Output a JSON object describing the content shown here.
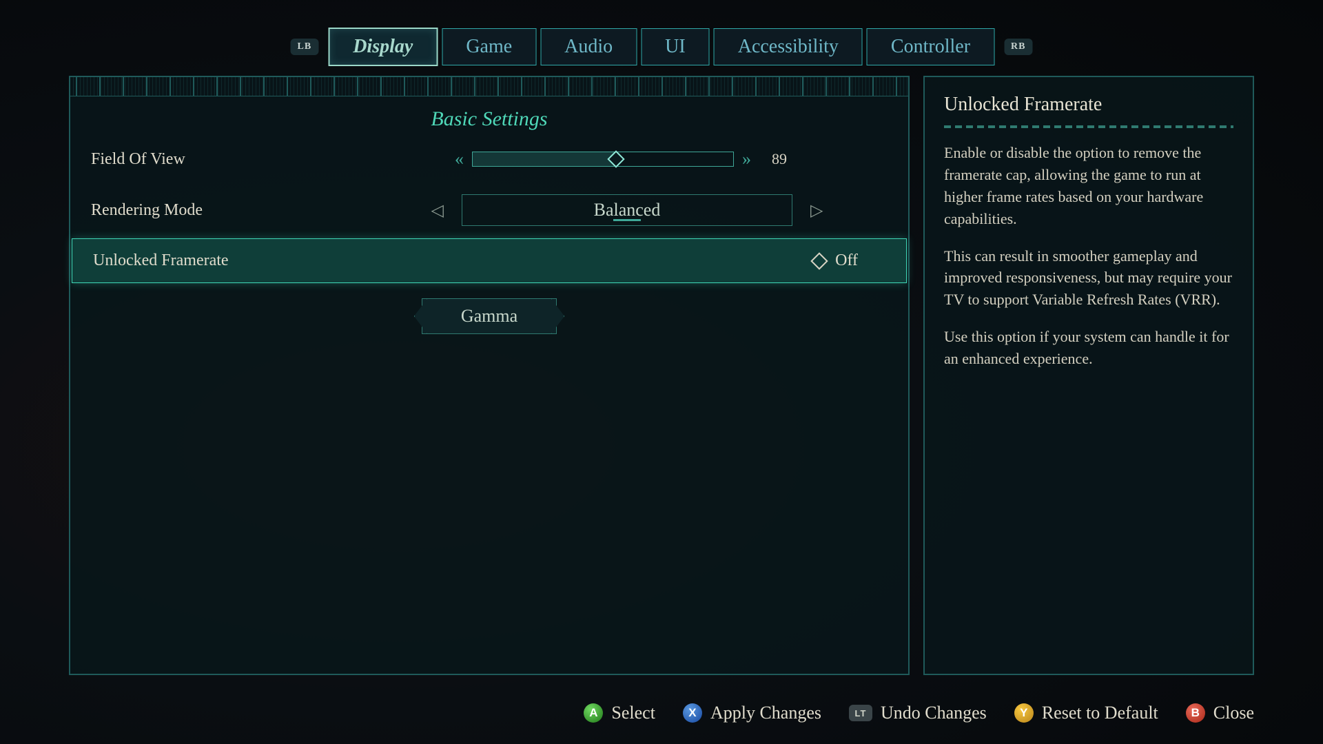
{
  "tabs": {
    "lb_hint": "LB",
    "rb_hint": "RB",
    "items": [
      "Display",
      "Game",
      "Audio",
      "UI",
      "Accessibility",
      "Controller"
    ],
    "active_index": 0
  },
  "panel": {
    "title": "Basic Settings",
    "fov": {
      "label": "Field Of View",
      "value": "89",
      "percent": 55
    },
    "rendering": {
      "label": "Rendering Mode",
      "value": "Balanced"
    },
    "unlocked": {
      "label": "Unlocked Framerate",
      "value": "Off"
    },
    "gamma": {
      "label": "Gamma"
    }
  },
  "help": {
    "title": "Unlocked Framerate",
    "p1": "Enable or disable the option to remove the framerate cap, allowing the game to run at higher frame rates based on your hardware capabilities.",
    "p2": "This can result in smoother gameplay and improved responsiveness, but may require your TV to support Variable Refresh Rates (VRR).",
    "p3": "Use this option if your system can handle it for an enhanced experience."
  },
  "footer": {
    "select": {
      "btn": "A",
      "label": "Select"
    },
    "apply": {
      "btn": "X",
      "label": "Apply Changes"
    },
    "undo": {
      "btn": "LT",
      "label": "Undo Changes"
    },
    "reset": {
      "btn": "Y",
      "label": "Reset to Default"
    },
    "close": {
      "btn": "B",
      "label": "Close"
    }
  }
}
